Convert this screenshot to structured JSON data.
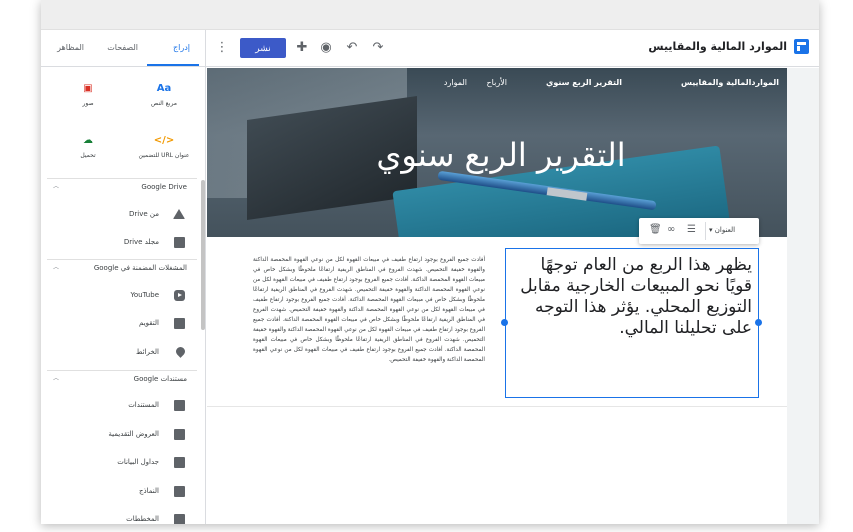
{
  "app": {
    "title": "الموارد المالية والمقاييس",
    "brand_color": "#1a73e8"
  },
  "toolbar": {
    "publish_label": "نشر",
    "icons": [
      "more-vert-icon",
      "add-person-icon",
      "preview-icon",
      "undo-icon",
      "redo-icon"
    ]
  },
  "panel": {
    "tabs": [
      {
        "label": "إدراج",
        "active": true
      },
      {
        "label": "الصفحات",
        "active": false
      },
      {
        "label": "المظاهر",
        "active": false
      }
    ],
    "tiles": [
      {
        "label": "مربع النص",
        "icon": "text-box-icon",
        "glyph": "Aa",
        "color": "#1a73e8"
      },
      {
        "label": "صور",
        "icon": "image-icon",
        "glyph": "▣",
        "color": "#d93025"
      },
      {
        "label": "عنوان URL للتضمين",
        "icon": "embed-icon",
        "glyph": "</>",
        "color": "#f29900"
      },
      {
        "label": "تحميل",
        "icon": "upload-icon",
        "glyph": "☁",
        "color": "#188038"
      }
    ],
    "drive": {
      "header": "Google Drive",
      "items": [
        {
          "label": "من Drive",
          "icon": "drive-icon"
        },
        {
          "label": "مجلد Drive",
          "icon": "drive-folder-icon"
        }
      ]
    },
    "embedded": {
      "header": "المشغلات المضمنة في Google",
      "items": [
        {
          "label": "YouTube",
          "icon": "youtube-icon"
        },
        {
          "label": "التقويم",
          "icon": "calendar-icon"
        },
        {
          "label": "الخرائط",
          "icon": "map-icon"
        }
      ]
    },
    "docs": {
      "header": "مستندات Google",
      "items": [
        {
          "label": "المستندات",
          "icon": "docs-icon"
        },
        {
          "label": "العروض التقديمية",
          "icon": "slides-icon"
        },
        {
          "label": "جداول البيانات",
          "icon": "sheets-icon"
        },
        {
          "label": "النماذج",
          "icon": "forms-icon"
        },
        {
          "label": "المخططات",
          "icon": "charts-icon"
        }
      ]
    }
  },
  "site": {
    "name": "المواردالمالية والمقاييس",
    "nav": [
      "التقرير الربع سنوي",
      "الأرباح",
      "الموارد"
    ],
    "hero_title": "التقرير الربع سنوي",
    "style_menu": "العنوان",
    "body_paragraph": "أفادت جميع الفروع بوجود ارتفاع طفيف في مبيعات القهوة لكل من نوعي القهوة المحمصة الداكنة والقهوة خفيفة التحميص. شهدت الفروع في المناطق الريفية ارتفاعًا ملحوظًا وبشكل خاص في مبيعات القهوة المحمصة الداكنة. أفادت جميع الفروع بوجود ارتفاع طفيف في مبيعات القهوة لكل من نوعي القهوة المحمصة الداكنة والقهوة خفيفة التحميص. شهدت الفروع في المناطق الريفية ارتفاعًا ملحوظًا وبشكل خاص في مبيعات القهوة المحمصة الداكنة. أفادت جميع الفروع بوجود ارتفاع طفيف في مبيعات القهوة لكل من نوعي القهوة المحمصة الداكنة والقهوة خفيفة التحميص. شهدت الفروع في المناطق الريفية ارتفاعًا ملحوظًا وبشكل خاص في مبيعات القهوة المحمصة الداكنة. أفادت جميع الفروع بوجود ارتفاع طفيف في مبيعات القهوة لكل من نوعي القهوة المحمصة الداكنة والقهوة خفيفة التحميص. شهدت الفروع في المناطق الريفية ارتفاعًا ملحوظًا وبشكل خاص في مبيعات القهوة المحمصة الداكنة. أفادت جميع الفروع بوجود ارتفاع طفيف في مبيعات القهوة لكل من نوعي القهوة المحمصة الداكنة والقهوة خفيفة التحميص.",
    "selected_text": "يظهر هذا الربع من العام توجهًا قويًا نحو المبيعات الخارجية مقابل التوزيع المحلي. يؤثر هذا التوجه على تحليلنا المالي."
  }
}
